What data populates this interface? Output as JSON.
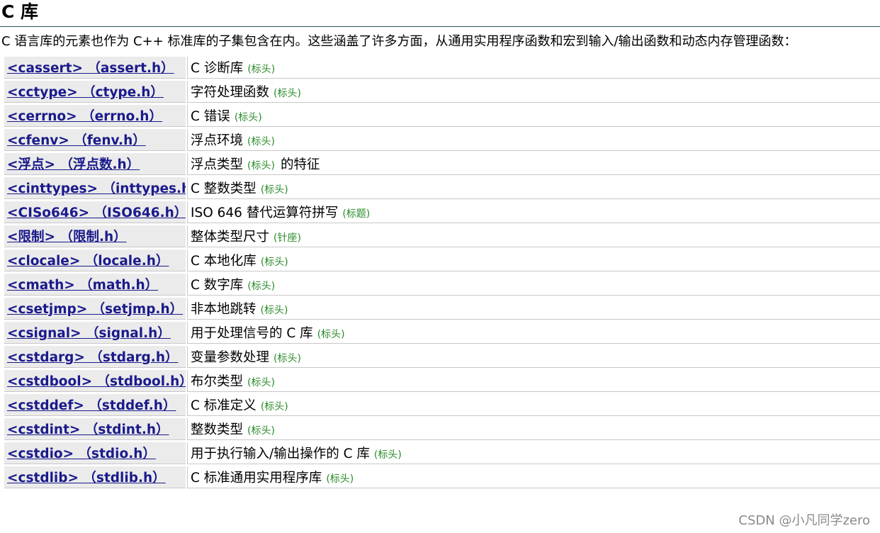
{
  "page": {
    "title": "C 库",
    "intro": "C 语言库的元素也作为 C++ 标准库的子集包含在内。这些涵盖了许多方面，从通用实用程序函数和宏到输入/输出函数和动态内存管理函数："
  },
  "libraries": [
    {
      "link": "<cassert> （assert.h）",
      "desc": "C 诊断库",
      "tag": "(标头)",
      "desc_after": ""
    },
    {
      "link": "<cctype> （ctype.h）",
      "desc": "字符处理函数",
      "tag": "(标头)",
      "desc_after": ""
    },
    {
      "link": "<cerrno> （errno.h）",
      "desc": "C 错误",
      "tag": "(标头)",
      "desc_after": ""
    },
    {
      "link": "<cfenv> （fenv.h）",
      "desc": "浮点环境",
      "tag": "(标头)",
      "desc_after": ""
    },
    {
      "link": "<浮点> （浮点数.h）",
      "desc": "浮点类型",
      "tag": "(标头)",
      "desc_after": "的特征"
    },
    {
      "link": "<cinttypes> （inttypes.h）",
      "desc": "C 整数类型",
      "tag": "(标头)",
      "desc_after": ""
    },
    {
      "link": "<CISo646> （ISO646.h）",
      "desc": "ISO 646 替代运算符拼写",
      "tag": "(标题)",
      "desc_after": ""
    },
    {
      "link": "<限制> （限制.h）",
      "desc": "整体类型尺寸",
      "tag": "(针座)",
      "desc_after": ""
    },
    {
      "link": "<clocale> （locale.h）",
      "desc": "C 本地化库",
      "tag": "(标头)",
      "desc_after": ""
    },
    {
      "link": "<cmath> （math.h）",
      "desc": "C 数字库",
      "tag": "(标头)",
      "desc_after": ""
    },
    {
      "link": "<csetjmp> （setjmp.h）",
      "desc": "非本地跳转",
      "tag": "(标头)",
      "desc_after": ""
    },
    {
      "link": "<csignal> （signal.h）",
      "desc": "用于处理信号的 C 库",
      "tag": "(标头)",
      "desc_after": ""
    },
    {
      "link": "<cstdarg> （stdarg.h）",
      "desc": "变量参数处理",
      "tag": "(标头)",
      "desc_after": ""
    },
    {
      "link": "<cstdbool> （stdbool.h）",
      "desc": "布尔类型",
      "tag": "(标头)",
      "desc_after": ""
    },
    {
      "link": "<cstddef> （stddef.h）",
      "desc": "C 标准定义",
      "tag": "(标头)",
      "desc_after": ""
    },
    {
      "link": "<cstdint> （stdint.h）",
      "desc": "整数类型",
      "tag": "(标头)",
      "desc_after": ""
    },
    {
      "link": "<cstdio> （stdio.h）",
      "desc": "用于执行输入/输出操作的 C 库",
      "tag": "(标头)",
      "desc_after": ""
    },
    {
      "link": "<cstdlib> （stdlib.h）",
      "desc": "C 标准通用实用程序库",
      "tag": "(标头)",
      "desc_after": ""
    }
  ],
  "watermark": "CSDN @小凡同学zero",
  "colors": {
    "link": "#1a1a8c",
    "tag": "#2a8a2a",
    "header_cell_bg": "#ebebeb"
  }
}
